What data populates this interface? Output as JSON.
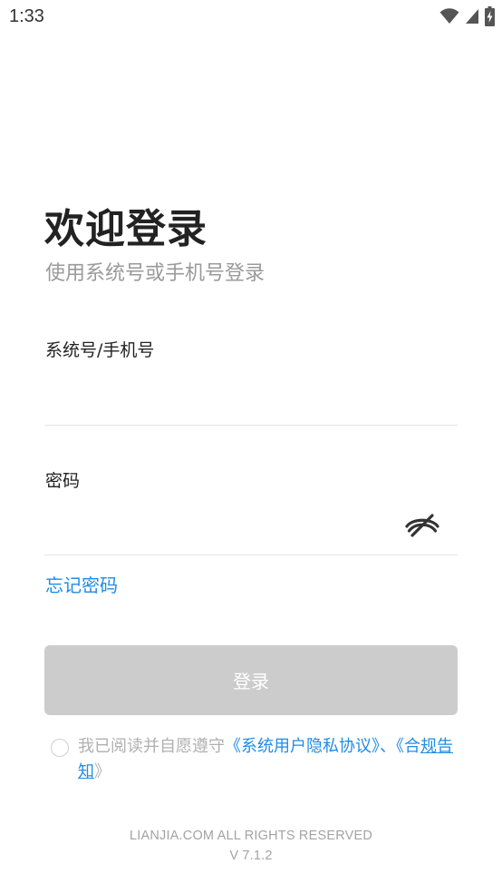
{
  "status_bar": {
    "time": "1:33",
    "icons": [
      "wifi-icon",
      "cellular-signal-icon",
      "battery-charging-icon"
    ]
  },
  "login": {
    "title": "欢迎登录",
    "subtitle": "使用系统号或手机号登录",
    "account_label": "系统号/手机号",
    "account_value": "",
    "password_label": "密码",
    "password_value": "",
    "password_visibility_icon": "eye-off-icon",
    "forgot_password": "忘记密码",
    "login_button": "登录"
  },
  "agreement": {
    "checked": false,
    "prefix": "我已阅读并自愿遵守",
    "privacy_link": "《系统用户隐私协议》",
    "separator": "、",
    "compliance_open": "《合",
    "compliance_rest": "规告知",
    "compliance_close": "》"
  },
  "footer": {
    "copyright": "LIANJIA.COM ALL RIGHTS RESERVED",
    "version": "V 7.1.2"
  },
  "colors": {
    "accent": "#1f8ce6",
    "button_disabled": "#cccccc",
    "title": "#222222",
    "subtitle": "#9a9a9a",
    "divider": "#e6e6e6"
  }
}
